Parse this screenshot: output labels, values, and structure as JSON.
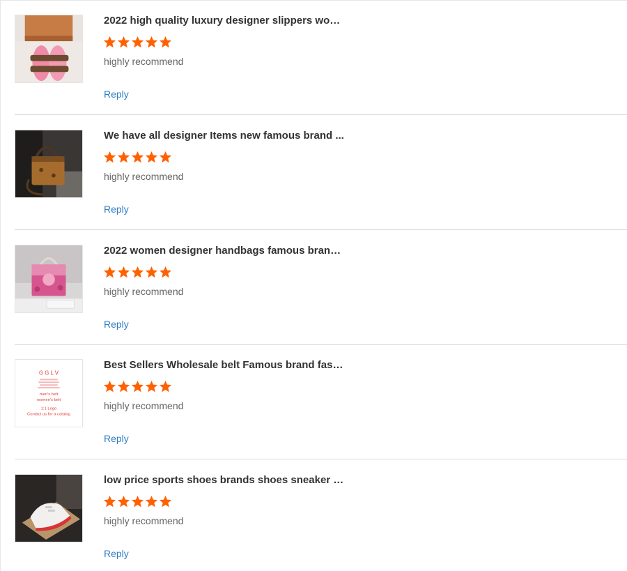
{
  "star_color": "#ff6000",
  "reply_color": "#2f7ec2",
  "reviews": [
    {
      "title": "2022 high quality luxury designer slippers wom...",
      "rating": 5,
      "comment": "highly recommend",
      "reply_label": "Reply",
      "thumbnail": "pink-slippers-photo"
    },
    {
      "title": "We have all designer Items new famous brand ...",
      "rating": 5,
      "comment": "highly recommend",
      "reply_label": "Reply",
      "thumbnail": "brown-tote-bag-photo"
    },
    {
      "title": "2022 women designer handbags famous brand...",
      "rating": 5,
      "comment": "highly recommend",
      "reply_label": "Reply",
      "thumbnail": "pink-handbag-photo"
    },
    {
      "title": "Best Sellers Wholesale belt Famous brand fash...",
      "rating": 5,
      "comment": "highly recommend",
      "reply_label": "Reply",
      "thumbnail": "belt-catalog-card",
      "thumbnail_text": {
        "brand_line": "G G   L V",
        "line_1": "men's belt",
        "line_2": "women's belt",
        "line_3": "1:1 Logo",
        "line_4": "Contact us for a catalog"
      }
    },
    {
      "title": "low price sports shoes brands shoes sneaker s...",
      "rating": 5,
      "comment": "highly recommend",
      "reply_label": "Reply",
      "thumbnail": "white-sneaker-photo"
    }
  ]
}
